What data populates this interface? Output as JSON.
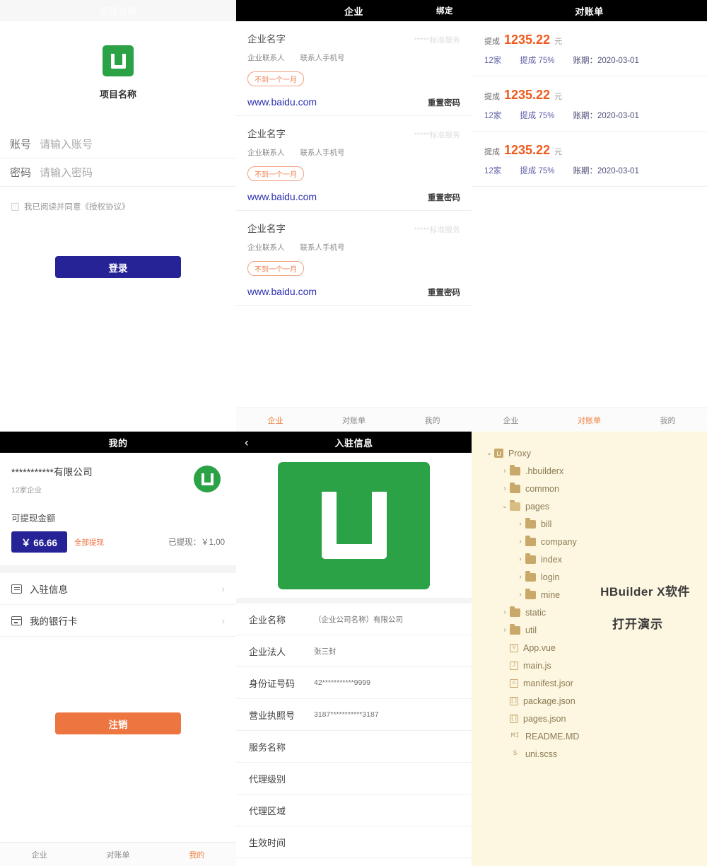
{
  "login": {
    "header_title": "项目名称",
    "logo_icon": "uniapp-u-logo",
    "project_name": "项目名称",
    "fields": [
      {
        "label": "账号",
        "placeholder": "请输入账号"
      },
      {
        "label": "密码",
        "placeholder": "请输入密码"
      }
    ],
    "agreement_text": "我已阅读并同意《授权协议》",
    "login_button": "登录"
  },
  "company": {
    "header_title": "企业",
    "header_action": "绑定",
    "cards": [
      {
        "name": "企业名字",
        "service": "*****标准服务",
        "contact": "企业联系人",
        "phone": "联系人手机号",
        "tag": "不到一个一月",
        "url": "www.baidu.com",
        "reset": "重置密码"
      },
      {
        "name": "企业名字",
        "service": "*****标准服务",
        "contact": "企业联系人",
        "phone": "联系人手机号",
        "tag": "不到一个一月",
        "url": "www.baidu.com",
        "reset": "重置密码"
      },
      {
        "name": "企业名字",
        "service": "*****标准服务",
        "contact": "企业联系人",
        "phone": "联系人手机号",
        "tag": "不到一个一月",
        "url": "www.baidu.com",
        "reset": "重置密码"
      }
    ],
    "tabbar": [
      {
        "label": "企业",
        "active": true
      },
      {
        "label": "对账单",
        "active": false
      },
      {
        "label": "我的",
        "active": false
      }
    ]
  },
  "bill": {
    "header_title": "对账单",
    "cards": [
      {
        "label": "提成",
        "amount": "1235.22",
        "unit": "元",
        "count": "12家",
        "rate": "提成 75%",
        "period": "账期：2020-03-01",
        "chevron": "›"
      },
      {
        "label": "提成",
        "amount": "1235.22",
        "unit": "元",
        "count": "12家",
        "rate": "提成 75%",
        "period": "账期：2020-03-01",
        "chevron": "›"
      },
      {
        "label": "提成",
        "amount": "1235.22",
        "unit": "元",
        "count": "12家",
        "rate": "提成 75%",
        "period": "账期：2020-03-01",
        "chevron": "›"
      }
    ],
    "tabbar": [
      {
        "label": "企业",
        "active": false
      },
      {
        "label": "对账单",
        "active": true
      },
      {
        "label": "我的",
        "active": false
      }
    ]
  },
  "mine": {
    "header_title": "我的",
    "company_name": "***********有限公司",
    "company_count": "12家企业",
    "avatar_icon": "uniapp-u-logo",
    "withdraw_label": "可提现金额",
    "withdraw_amount": "￥ 66.66",
    "withdraw_all": "全部提现",
    "withdrawn": "已提现：￥1.00",
    "items": [
      {
        "label": "入驻信息",
        "icon": "document-icon",
        "chevron": "›"
      },
      {
        "label": "我的银行卡",
        "icon": "bank-card-icon",
        "chevron": "›"
      }
    ],
    "logout_button": "注销",
    "tabbar": [
      {
        "label": "企业",
        "active": false
      },
      {
        "label": "对账单",
        "active": false
      },
      {
        "label": "我的",
        "active": true
      }
    ]
  },
  "settle": {
    "header_title": "入驻信息",
    "back_icon": "chevron-left-icon",
    "logo_icon": "uniapp-u-logo",
    "rows": [
      {
        "key": "企业名称",
        "value": "（企业公司名称）有限公司"
      },
      {
        "key": "企业法人",
        "value": "张三封"
      },
      {
        "key": "身份证号码",
        "value": "42***********9999"
      },
      {
        "key": "营业执照号",
        "value": "3187***********3187"
      },
      {
        "key": "服务名称",
        "value": ""
      },
      {
        "key": "代理级别",
        "value": ""
      },
      {
        "key": "代理区域",
        "value": ""
      },
      {
        "key": "生效时间",
        "value": ""
      }
    ]
  },
  "ide": {
    "note_line1": "HBuilder X软件",
    "note_line2": "打开演示",
    "tree": [
      {
        "label": "Proxy",
        "depth": 0,
        "twisty": "v",
        "icon": "uni-project-icon"
      },
      {
        "label": ".hbuilderx",
        "depth": 1,
        "twisty": ">",
        "icon": "folder-icon"
      },
      {
        "label": "common",
        "depth": 1,
        "twisty": ">",
        "icon": "folder-icon"
      },
      {
        "label": "pages",
        "depth": 1,
        "twisty": "v",
        "icon": "folder-open-icon"
      },
      {
        "label": "bill",
        "depth": 2,
        "twisty": ">",
        "icon": "folder-icon"
      },
      {
        "label": "company",
        "depth": 2,
        "twisty": ">",
        "icon": "folder-icon"
      },
      {
        "label": "index",
        "depth": 2,
        "twisty": ">",
        "icon": "folder-icon"
      },
      {
        "label": "login",
        "depth": 2,
        "twisty": ">",
        "icon": "folder-icon"
      },
      {
        "label": "mine",
        "depth": 2,
        "twisty": ">",
        "icon": "folder-icon"
      },
      {
        "label": "static",
        "depth": 1,
        "twisty": ">",
        "icon": "folder-icon"
      },
      {
        "label": "util",
        "depth": 1,
        "twisty": ">",
        "icon": "folder-icon"
      },
      {
        "label": "App.vue",
        "depth": 1,
        "twisty": "",
        "icon": "vue-file-icon",
        "glyph": "V"
      },
      {
        "label": "main.js",
        "depth": 1,
        "twisty": "",
        "icon": "js-file-icon",
        "glyph": "J"
      },
      {
        "label": "manifest.jsor",
        "depth": 1,
        "twisty": "",
        "icon": "manifest-file-icon",
        "glyph": "o"
      },
      {
        "label": "package.json",
        "depth": 1,
        "twisty": "",
        "icon": "json-file-icon",
        "glyph": "[ ]"
      },
      {
        "label": "pages.json",
        "depth": 1,
        "twisty": "",
        "icon": "json-file-icon",
        "glyph": "[ ]"
      },
      {
        "label": "README.MD",
        "depth": 1,
        "twisty": "",
        "icon": "markdown-file-icon",
        "glyph": "MI"
      },
      {
        "label": "uni.scss",
        "depth": 1,
        "twisty": "",
        "icon": "scss-file-icon",
        "glyph": "S"
      }
    ]
  },
  "colors": {
    "brand_green": "#2ba245",
    "primary_blue": "#262396",
    "accent_orange": "#ec7540",
    "amount_red": "#ef5a1e",
    "link_blue": "#2b2fae",
    "ide_bg": "#fdf6e0"
  }
}
